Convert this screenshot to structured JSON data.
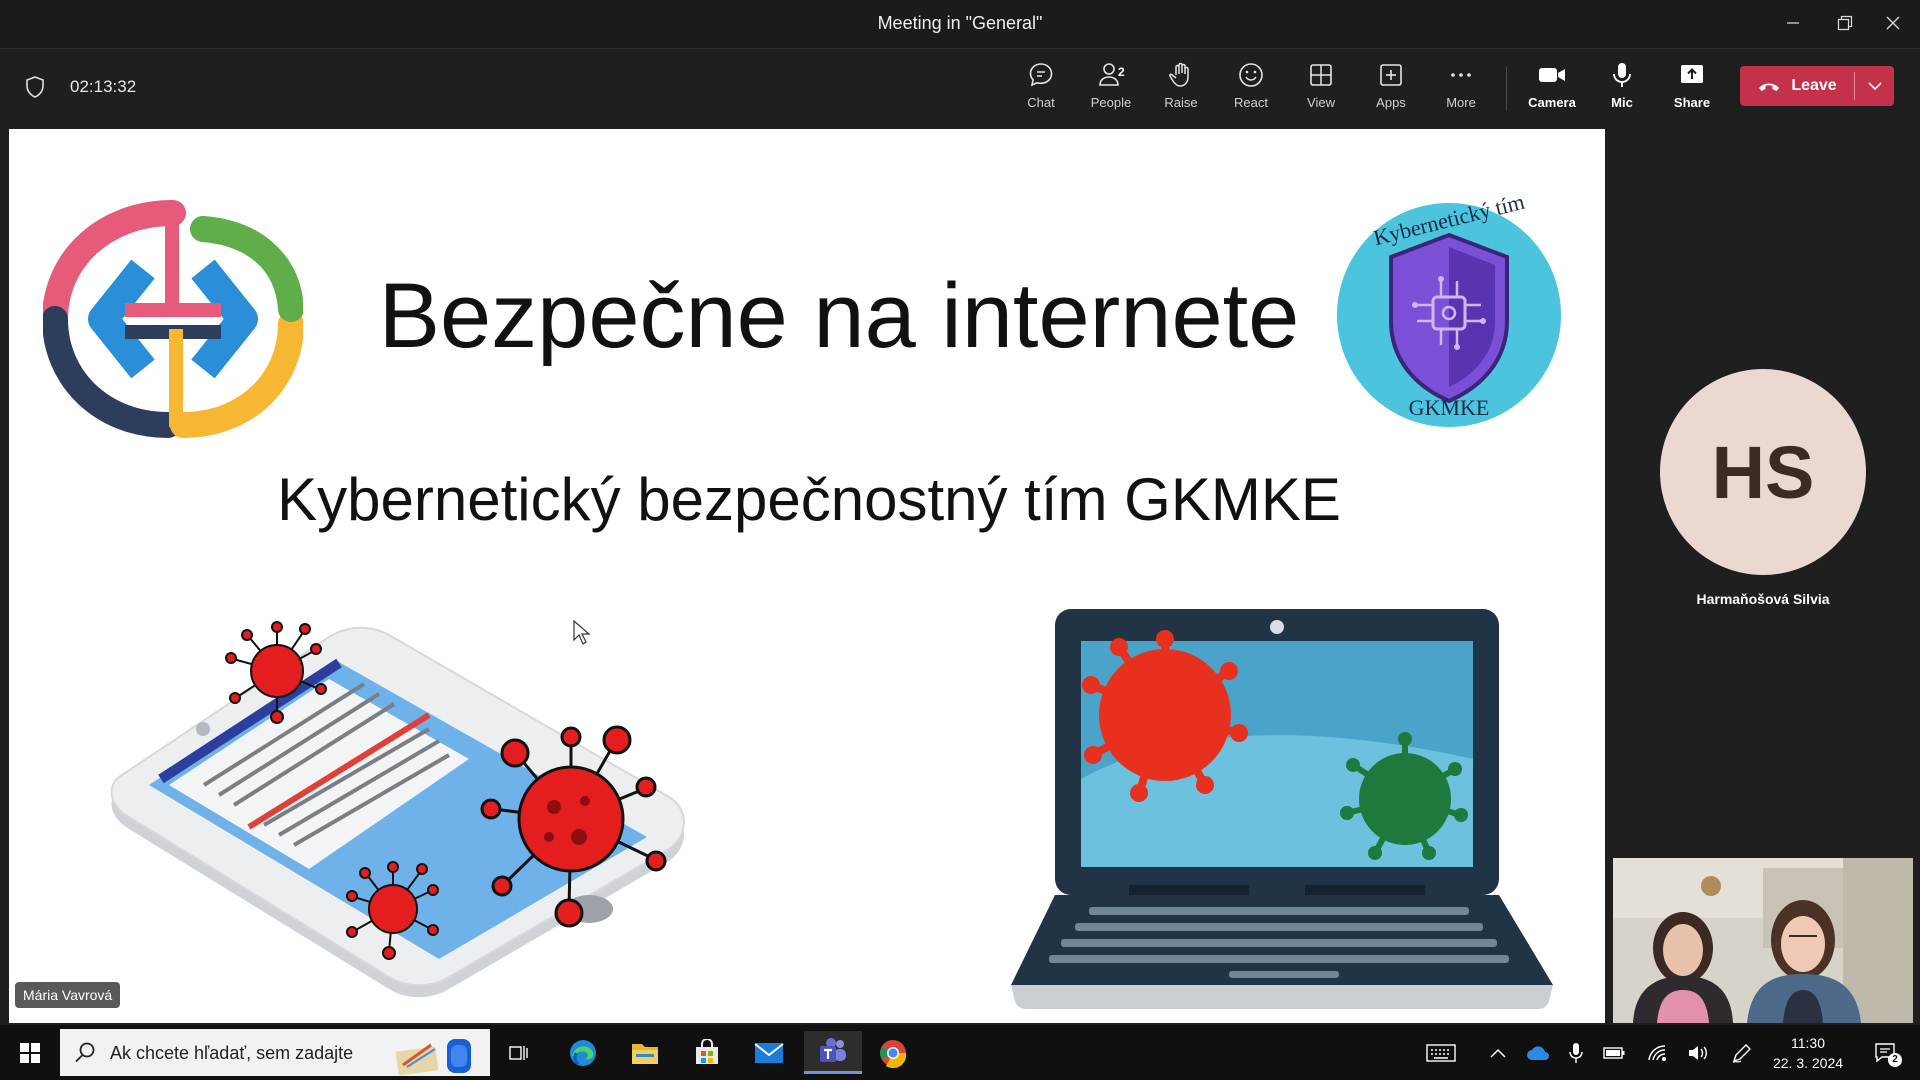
{
  "window": {
    "title": "Meeting in \"General\""
  },
  "toolbar": {
    "timer": "02:13:32",
    "chat": "Chat",
    "people": "People",
    "people_count": "2",
    "raise": "Raise",
    "react": "React",
    "view": "View",
    "apps": "Apps",
    "more": "More",
    "camera": "Camera",
    "mic": "Mic",
    "share": "Share",
    "leave": "Leave"
  },
  "slide": {
    "title": "Bezpečne na internete",
    "subtitle": "Kybernetický bezpečnostný tím GKMKE",
    "badge_top": "Kybernetický tím",
    "badge_bottom": "GKMKE"
  },
  "presenter": {
    "name": "Mária Vavrová"
  },
  "participant": {
    "initials": "HS",
    "name": "Harmaňošová Silvia"
  },
  "taskbar": {
    "search_placeholder": "Ak chcete hľadať, sem zadajte",
    "time": "11:30",
    "date": "22. 3. 2024",
    "notifications": "2"
  },
  "colors": {
    "leave": "#c4314b",
    "toolbar": "#1f1f1f",
    "virus": "#e41e1e"
  }
}
